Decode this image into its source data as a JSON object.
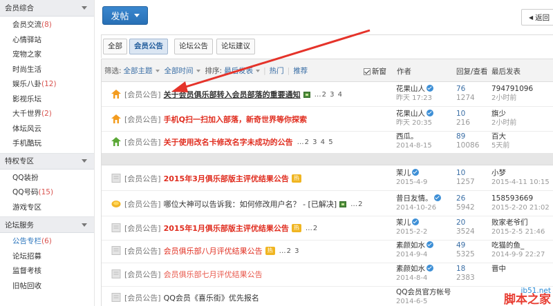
{
  "sidebar": {
    "sections": [
      {
        "title": "会员综合",
        "items": [
          {
            "label": "会员交流",
            "count": "(8)"
          },
          {
            "label": "心情驿站",
            "count": ""
          },
          {
            "label": "宠物之家",
            "count": ""
          },
          {
            "label": "时尚生活",
            "count": ""
          },
          {
            "label": "娱乐八卦",
            "count": "(12)"
          },
          {
            "label": "影视乐坛",
            "count": ""
          },
          {
            "label": "大千世界",
            "count": "(2)"
          },
          {
            "label": "体坛风云",
            "count": ""
          },
          {
            "label": "手机酷玩",
            "count": ""
          }
        ]
      },
      {
        "title": "特权专区",
        "items": [
          {
            "label": "QQ装扮",
            "count": ""
          },
          {
            "label": "QQ号码",
            "count": "(15)"
          },
          {
            "label": "游戏专区",
            "count": ""
          }
        ]
      },
      {
        "title": "论坛服务",
        "items": [
          {
            "label": "公告专栏",
            "count": "(6)"
          },
          {
            "label": "论坛招募",
            "count": ""
          },
          {
            "label": "监督考核",
            "count": ""
          },
          {
            "label": "旧帖回收",
            "count": ""
          }
        ]
      }
    ]
  },
  "toolbar": {
    "post_label": "发帖",
    "back_label": "返回"
  },
  "tabs": [
    "全部",
    "会员公告",
    "论坛公告",
    "论坛建议"
  ],
  "active_tab": "会员公告",
  "filter": {
    "prefix": "筛选:",
    "all_topics": "全部主题",
    "all_time": "全部时间",
    "sort_prefix": "排序:",
    "sort_value": "最后发表",
    "hot": "热门",
    "recommend": "推荐",
    "new_window": "新窗"
  },
  "columns": {
    "author": "作者",
    "stats": "回复/查看",
    "last": "最后发表"
  },
  "threads": [
    {
      "icon": "orange-home",
      "tag": "[会员公告]",
      "title": "关于会员俱乐部转入会员部落的重要通知",
      "style": "dark",
      "has_img": true,
      "hot": false,
      "pages": "…2 3 4",
      "author": "花果山人",
      "verified": true,
      "date": "昨天 17:23",
      "replies": "76",
      "views": "1274",
      "last_user": "794791096",
      "last_time": "2小时前"
    },
    {
      "icon": "orange-home",
      "tag": "[会员公告]",
      "title": "手机Q扫一扫加入部落，新奇世界等你探索",
      "style": "red",
      "has_img": false,
      "hot": false,
      "pages": "",
      "author": "花果山人",
      "verified": true,
      "date": "昨天 20:35",
      "replies": "10",
      "views": "216",
      "last_user": "旗少",
      "last_time": "2小时前"
    },
    {
      "icon": "green-home",
      "tag": "[会员公告]",
      "title": "关于使用改名卡修改名字未成功的公告",
      "style": "red",
      "has_img": false,
      "hot": false,
      "pages": "…2 3 4 5",
      "author": "西瓜。",
      "verified": false,
      "date": "2014-8-15",
      "replies": "89",
      "views": "10086",
      "last_user": "百大",
      "last_time": "5天前"
    },
    {
      "icon": "doc",
      "tag": "[会员公告]",
      "title": "2015年3月俱乐部版主评优结果公告",
      "style": "red",
      "has_img": false,
      "hot": true,
      "pages": "",
      "author": "茉儿",
      "verified": true,
      "date": "2015-4-9",
      "replies": "10",
      "views": "1257",
      "last_user": "小梦",
      "last_time": "2015-4-11 10:15"
    },
    {
      "icon": "coin",
      "tag": "[会员公告]",
      "title": "哪位大神可以告诉我：如何修改用户名？ - [已解决]",
      "style": "plain",
      "has_img": true,
      "hot": false,
      "pages": "…2",
      "author": "昔日友情。",
      "verified": true,
      "date": "2014-10-26",
      "replies": "26",
      "views": "5942",
      "last_user": "158593669",
      "last_time": "2015-2-20 21:02"
    },
    {
      "icon": "doc",
      "tag": "[会员公告]",
      "title": "2015年1月俱乐部版主评优结果公告",
      "style": "red",
      "has_img": false,
      "hot": true,
      "pages": "…2",
      "author": "茉儿",
      "verified": true,
      "date": "2015-2-2",
      "replies": "20",
      "views": "3524",
      "last_user": "败家老爷们",
      "last_time": "2015-2-5 21:46"
    },
    {
      "icon": "doc",
      "tag": "[会员公告]",
      "title": "会员俱乐部八月评优结果公告",
      "style": "redthin",
      "has_img": false,
      "hot": true,
      "pages": "…2 3",
      "author": "素颜如水",
      "verified": true,
      "date": "2014-9-4",
      "replies": "49",
      "views": "5325",
      "last_user": "吃猫的鱼_",
      "last_time": "2014-9-9 22:27"
    },
    {
      "icon": "doc",
      "tag": "[会员公告]",
      "title": "会员俱乐部七月评优结果公告",
      "style": "redlight",
      "has_img": false,
      "hot": false,
      "pages": "",
      "author": "素颜如水",
      "verified": true,
      "date": "2014-8-4",
      "replies": "18",
      "views": "2383",
      "last_user": "晋中",
      "last_time": ""
    },
    {
      "icon": "doc",
      "tag": "[会员公告]",
      "title": "QQ会员《喜乐街》优先报名",
      "style": "plain",
      "has_img": false,
      "hot": false,
      "pages": "",
      "author": "QQ会员官方帐号",
      "verified": false,
      "date": "2014-6-5",
      "replies": "",
      "views": "",
      "last_user": "",
      "last_time": ""
    }
  ],
  "hot_badge": "热",
  "colors": {
    "accent": "#2b75bd",
    "title_red": "#e02d1f",
    "arrow": "#e5332a"
  },
  "watermark": {
    "site": "jb51.net",
    "name": "脚本之家"
  }
}
